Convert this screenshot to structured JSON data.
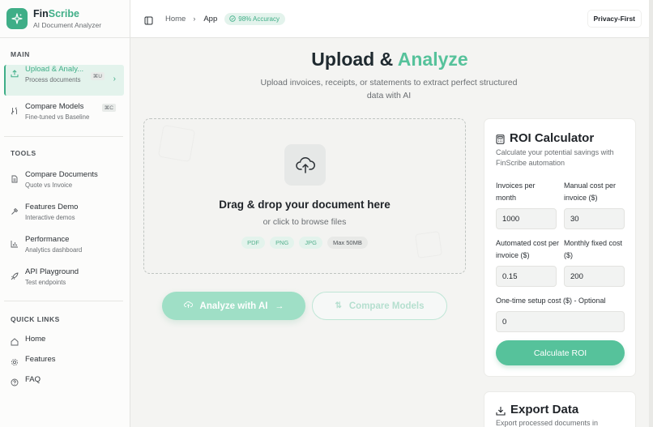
{
  "brand": {
    "name_part1": "Fin",
    "name_part2": "Scribe",
    "subtitle": "AI Document Analyzer"
  },
  "sidebar": {
    "main_label": "MAIN",
    "main_items": [
      {
        "title": "Upload & Analy...",
        "sub": "Process documents",
        "shortcut": "⌘U",
        "icon": "upload-icon"
      },
      {
        "title": "Compare Models",
        "sub": "Fine-tuned vs Baseline",
        "shortcut": "⌘C",
        "icon": "compare-arrows-icon"
      }
    ],
    "tools_label": "TOOLS",
    "tools_items": [
      {
        "title": "Compare Documents",
        "sub": "Quote vs Invoice",
        "icon": "document-icon"
      },
      {
        "title": "Features Demo",
        "sub": "Interactive demos",
        "icon": "wand-icon"
      },
      {
        "title": "Performance",
        "sub": "Analytics dashboard",
        "icon": "bar-chart-icon"
      },
      {
        "title": "API Playground",
        "sub": "Test endpoints",
        "icon": "rocket-icon"
      }
    ],
    "quick_label": "QUICK LINKS",
    "quick_items": [
      {
        "title": "Home",
        "icon": "home-icon"
      },
      {
        "title": "Features",
        "icon": "gear-icon"
      },
      {
        "title": "FAQ",
        "icon": "help-circle-icon"
      }
    ]
  },
  "topbar": {
    "crumb_home": "Home",
    "crumb_app": "App",
    "accuracy_badge": "98% Accuracy",
    "privacy": "Privacy-First"
  },
  "main": {
    "title_part1": "Upload & ",
    "title_part2": "Analyze",
    "subtitle": "Upload invoices, receipts, or statements to extract perfect structured data with AI",
    "dropzone": {
      "title": "Drag & drop your document here",
      "sub": "or click to browse files",
      "formats": [
        "PDF",
        "PNG",
        "JPG"
      ],
      "max_size": "Max 50MB"
    },
    "analyze_button": "Analyze with AI",
    "compare_button": "Compare Models"
  },
  "roi": {
    "title": "ROI Calculator",
    "desc": "Calculate your potential savings with FinScribe automation",
    "fields": {
      "invoices_label": "Invoices per month",
      "invoices_value": "1000",
      "manual_label": "Manual cost per invoice ($)",
      "manual_value": "30",
      "automated_label": "Automated cost per invoice ($)",
      "automated_value": "0.15",
      "fixed_label": "Monthly fixed cost ($)",
      "fixed_value": "200",
      "setup_label": "One-time setup cost ($) - Optional",
      "setup_value": "0"
    },
    "button": "Calculate ROI"
  },
  "export": {
    "title": "Export Data",
    "desc": "Export processed documents in"
  },
  "colors": {
    "accent": "#3fae87",
    "accent_light": "#56c29b",
    "accent_bg": "#e3f3ec"
  }
}
